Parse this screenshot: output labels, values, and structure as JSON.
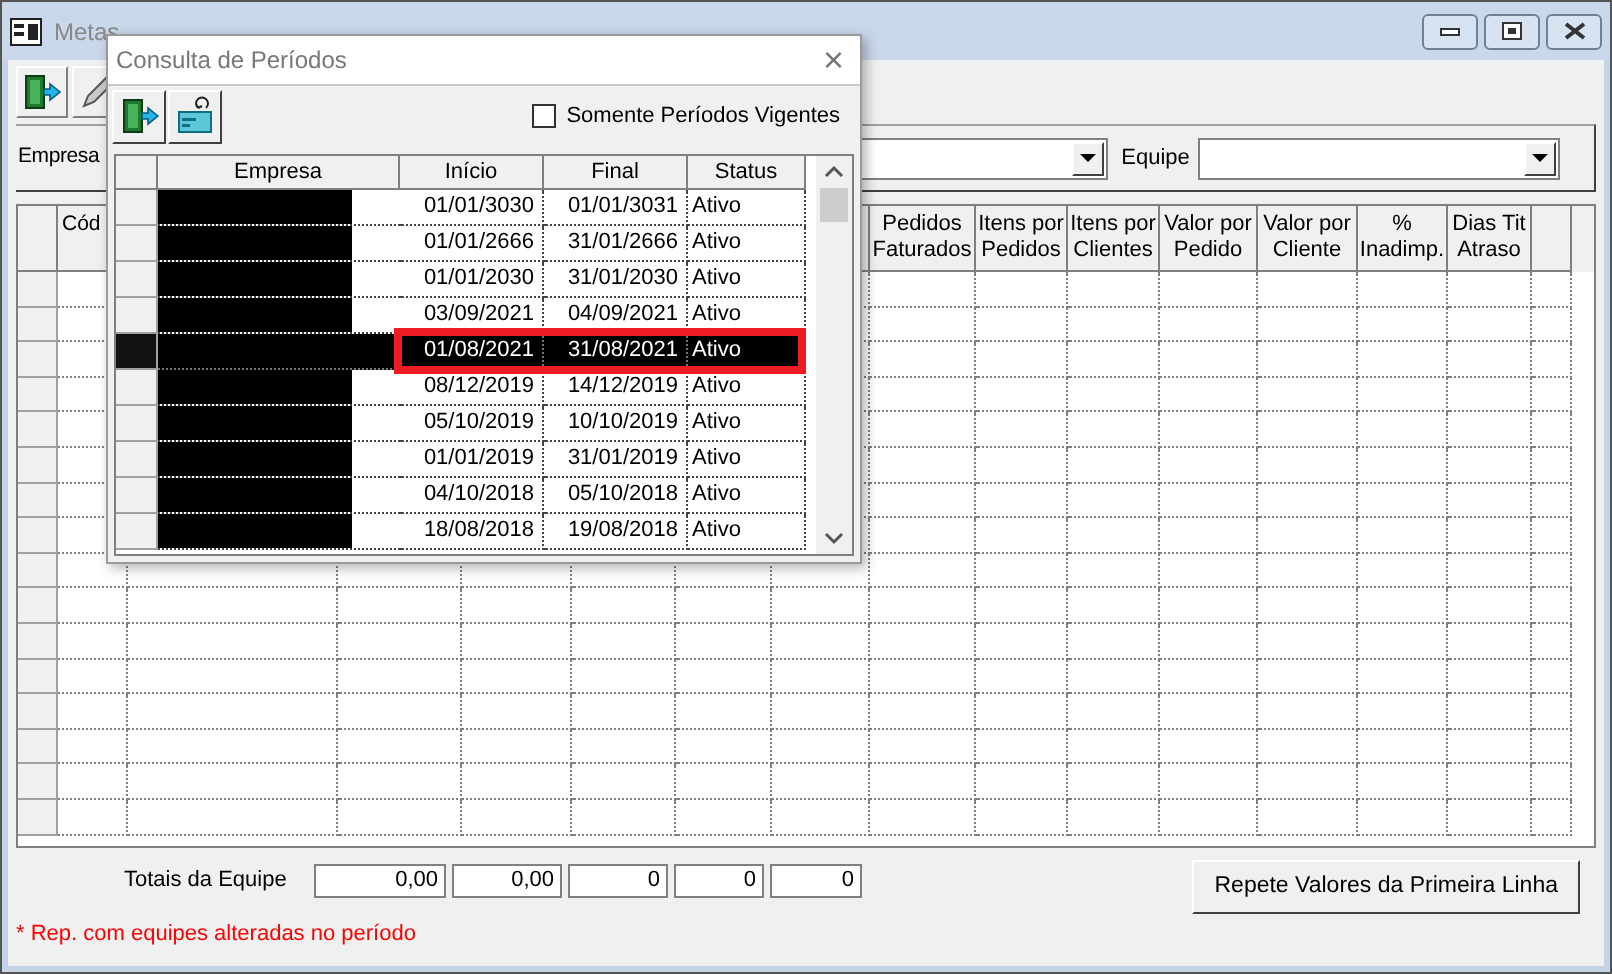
{
  "window": {
    "title": "Metas"
  },
  "filters": {
    "empresa_label": "Empresa",
    "equipe_label": "Equipe"
  },
  "main_grid": {
    "columns": [
      "Cód",
      "Pedidos\nFaturados",
      "Itens por\nPedidos",
      "Itens por\nClientes",
      "Valor por\nPedido",
      "Valor por\nCliente",
      "%\nInadimp.",
      "Dias Tit\nAtraso"
    ]
  },
  "totals": {
    "label": "Totais da Equipe",
    "values": [
      "0,00",
      "0,00",
      "0",
      "0",
      "0"
    ]
  },
  "repeat_button": "Repete Valores da Primeira Linha",
  "note": "* Rep. com equipes alteradas no período",
  "dialog": {
    "title": "Consulta de Períodos",
    "close": "×",
    "filter_checkbox": {
      "label": "Somente Períodos Vigentes",
      "checked": false
    },
    "columns": [
      "Empresa",
      "Início",
      "Final",
      "Status"
    ],
    "rows": [
      {
        "inicio": "01/01/3030",
        "final": "01/01/3031",
        "status": "Ativo",
        "selected": false
      },
      {
        "inicio": "01/01/2666",
        "final": "31/01/2666",
        "status": "Ativo",
        "selected": false
      },
      {
        "inicio": "01/01/2030",
        "final": "31/01/2030",
        "status": "Ativo",
        "selected": false
      },
      {
        "inicio": "03/09/2021",
        "final": "04/09/2021",
        "status": "Ativo",
        "selected": false
      },
      {
        "inicio": "01/08/2021",
        "final": "31/08/2021",
        "status": "Ativo",
        "selected": true
      },
      {
        "inicio": "08/12/2019",
        "final": "14/12/2019",
        "status": "Ativo",
        "selected": false
      },
      {
        "inicio": "05/10/2019",
        "final": "10/10/2019",
        "status": "Ativo",
        "selected": false
      },
      {
        "inicio": "01/01/2019",
        "final": "31/01/2019",
        "status": "Ativo",
        "selected": false
      },
      {
        "inicio": "04/10/2018",
        "final": "05/10/2018",
        "status": "Ativo",
        "selected": false
      },
      {
        "inicio": "18/08/2018",
        "final": "19/08/2018",
        "status": "Ativo",
        "selected": false
      }
    ]
  }
}
